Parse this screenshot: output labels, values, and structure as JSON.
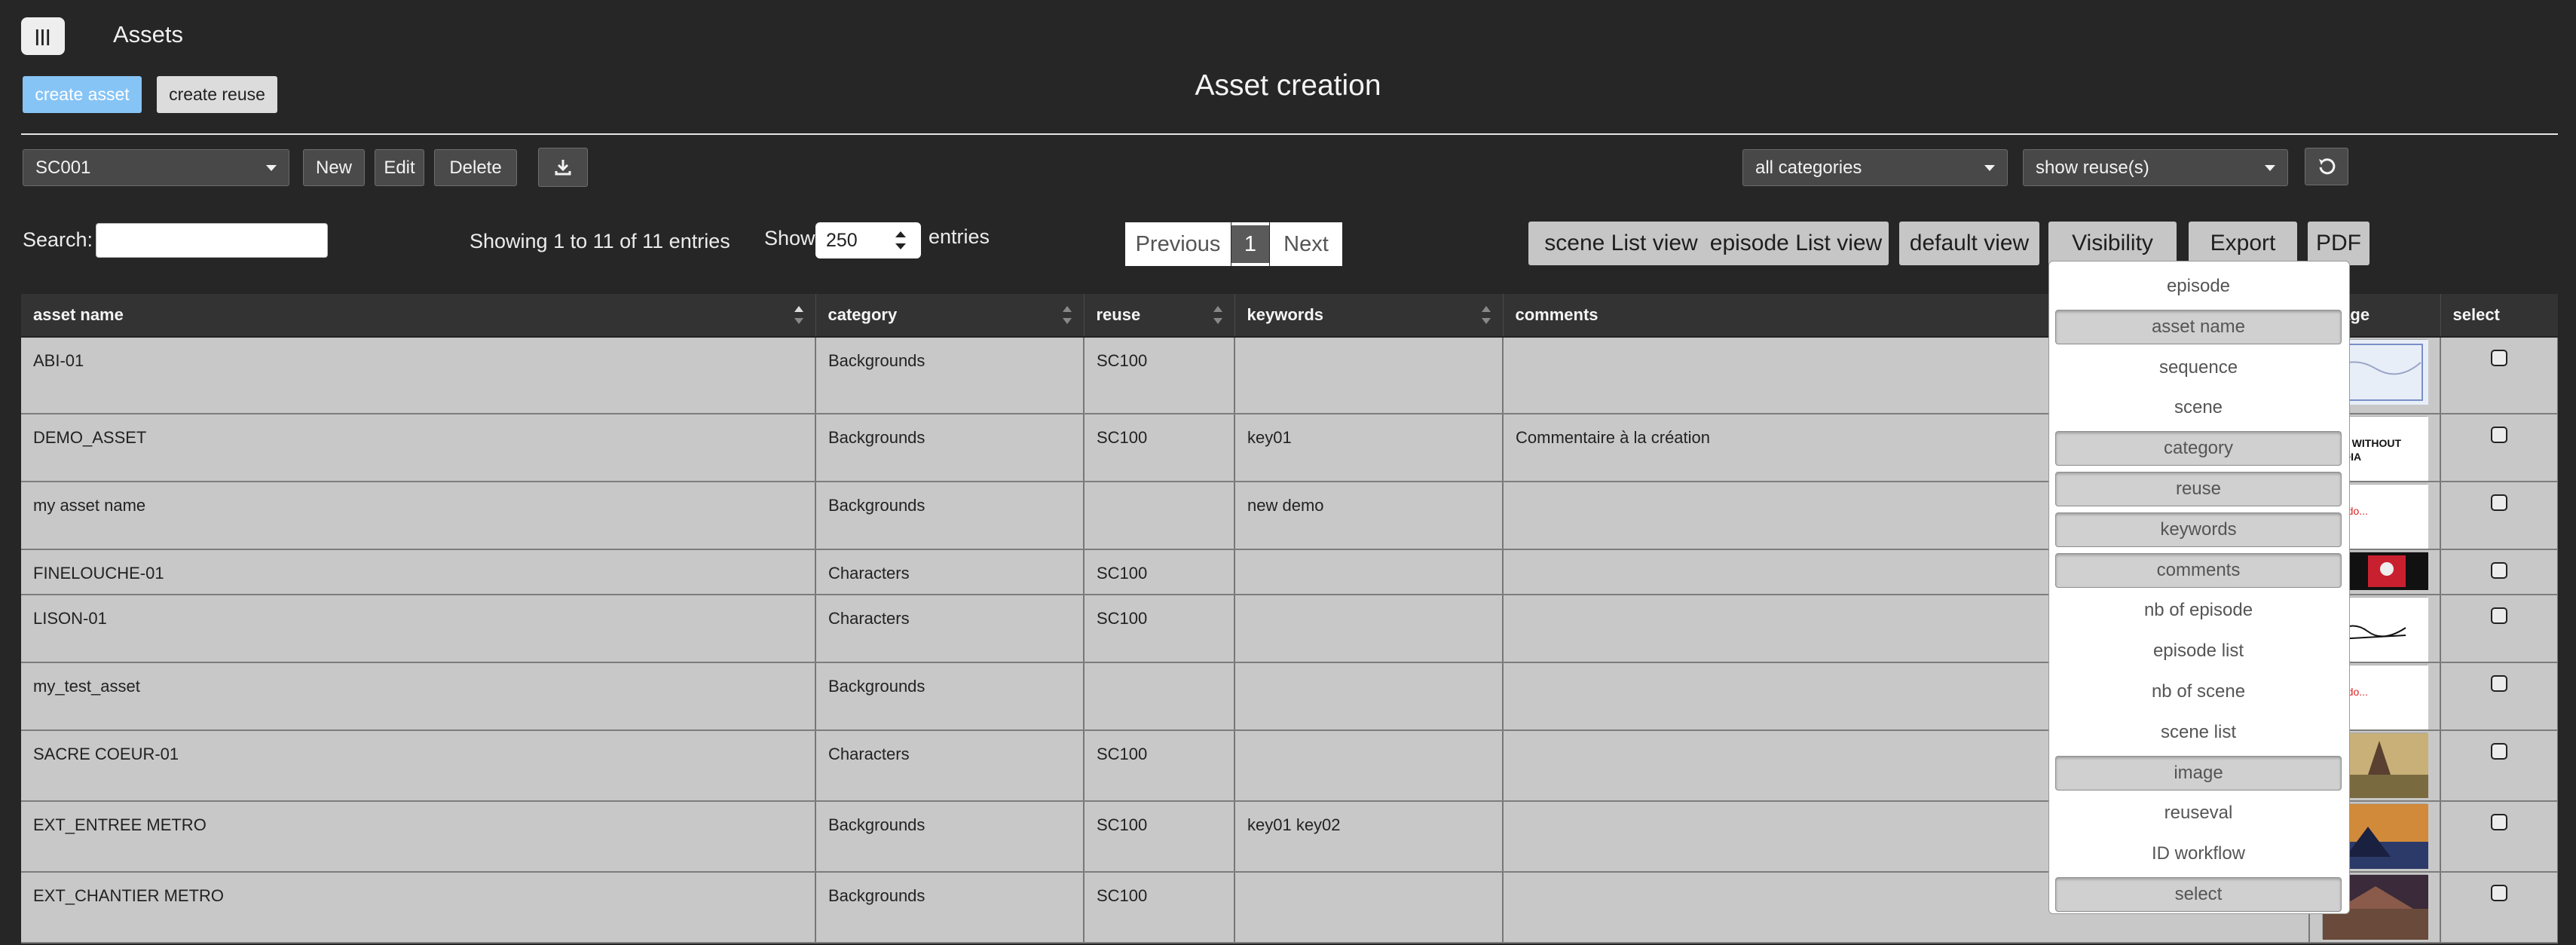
{
  "header": {
    "app_title": "Assets",
    "page_title": "Asset creation",
    "menu_icon_glyph": "|||"
  },
  "actions": {
    "create_asset": "create asset",
    "create_reuse": "create reuse"
  },
  "toolbar": {
    "scene_select": "SC001",
    "new_label": "New",
    "edit_label": "Edit",
    "delete_label": "Delete",
    "category_select": "all categories",
    "reuse_select": "show reuse(s)"
  },
  "listing": {
    "search_label": "Search:",
    "search_value": "",
    "showing_text": "Showing 1 to 11 of 11 entries",
    "show_label": "Show",
    "show_value": "250",
    "entries_label": "entries"
  },
  "pagination": {
    "previous": "Previous",
    "page": "1",
    "next": "Next"
  },
  "views": {
    "scene_list": "scene List view",
    "episode_list": "episode List view",
    "default": "default view",
    "visibility": "Visibility",
    "export": "Export",
    "pdf": "PDF"
  },
  "table": {
    "headers": {
      "asset_name": "asset name",
      "category": "category",
      "reuse": "reuse",
      "keywords": "keywords",
      "comments": "comments",
      "image": "image",
      "select": "select"
    },
    "rows": [
      {
        "asset_name": "ABI-01",
        "category": "Backgrounds",
        "reuse": "SC100",
        "keywords": "",
        "comments": ""
      },
      {
        "asset_name": "DEMO_ASSET",
        "category": "Backgrounds",
        "reuse": "SC100",
        "keywords": "key01",
        "comments": "Commentaire à la création"
      },
      {
        "asset_name": "my asset name",
        "category": "Backgrounds",
        "reuse": "",
        "keywords": "new demo",
        "comments": ""
      },
      {
        "asset_name": "FINELOUCHE-01",
        "category": "Characters",
        "reuse": "SC100",
        "keywords": "",
        "comments": ""
      },
      {
        "asset_name": "LISON-01",
        "category": "Characters",
        "reuse": "SC100",
        "keywords": "",
        "comments": ""
      },
      {
        "asset_name": "my_test_asset",
        "category": "Backgrounds",
        "reuse": "",
        "keywords": "",
        "comments": ""
      },
      {
        "asset_name": "SACRE COEUR-01",
        "category": "Characters",
        "reuse": "SC100",
        "keywords": "",
        "comments": ""
      },
      {
        "asset_name": "EXT_ENTREE METRO",
        "category": "Backgrounds",
        "reuse": "SC100",
        "keywords": "key01 key02",
        "comments": ""
      },
      {
        "asset_name": "EXT_CHANTIER METRO",
        "category": "Backgrounds",
        "reuse": "SC100",
        "keywords": "",
        "comments": ""
      }
    ]
  },
  "visibility_menu": {
    "items": [
      {
        "label": "episode",
        "checked": false
      },
      {
        "label": "asset name",
        "checked": true
      },
      {
        "label": "sequence",
        "checked": false
      },
      {
        "label": "scene",
        "checked": false
      },
      {
        "label": "category",
        "checked": true
      },
      {
        "label": "reuse",
        "checked": true
      },
      {
        "label": "keywords",
        "checked": true
      },
      {
        "label": "comments",
        "checked": true
      },
      {
        "label": "nb of episode",
        "checked": false
      },
      {
        "label": "episode list",
        "checked": false
      },
      {
        "label": "nb of scene",
        "checked": false
      },
      {
        "label": "scene list",
        "checked": false
      },
      {
        "label": "image",
        "checked": true
      },
      {
        "label": "reuseval",
        "checked": false
      },
      {
        "label": "ID workflow",
        "checked": false
      },
      {
        "label": "select",
        "checked": true
      }
    ]
  },
  "colors": {
    "background": "#262626",
    "accent_blue": "#86c4f6",
    "row_bg": "#c8c8c8"
  }
}
